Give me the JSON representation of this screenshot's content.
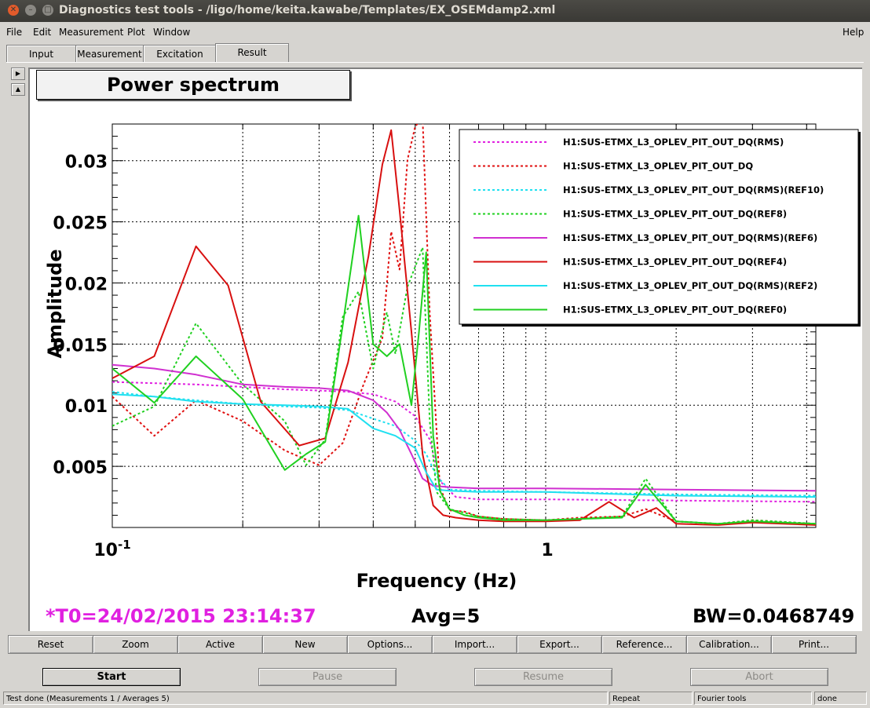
{
  "window": {
    "title": "Diagnostics test tools - /ligo/home/keita.kawabe/Templates/EX_OSEMdamp2.xml"
  },
  "menu": {
    "file": "File",
    "edit": "Edit",
    "measurement": "Measurement",
    "plot": "Plot",
    "window": "Window",
    "help": "Help"
  },
  "tabs": [
    "Input",
    "Measurement",
    "Excitation",
    "Result"
  ],
  "active_tab": "Result",
  "plot": {
    "title": "Power spectrum",
    "t0": "*T0=24/02/2015 23:14:37",
    "avg": "Avg=5",
    "bw": "BW=0.0468749"
  },
  "chart_data": {
    "type": "line",
    "title": "Power spectrum",
    "xlabel": "Frequency (Hz)",
    "ylabel": "Amplitude",
    "xscale": "log",
    "xlim": [
      0.1,
      4.2
    ],
    "ylim": [
      0,
      0.033
    ],
    "grid": true,
    "legend_position": "top-right",
    "x_ticks": [
      {
        "value": 0.1,
        "label": "10",
        "sup": "-1"
      },
      {
        "value": 1,
        "label": "1",
        "sup": ""
      }
    ],
    "y_ticks": [
      0.005,
      0.01,
      0.015,
      0.02,
      0.025,
      0.03
    ],
    "y_tick_labels": [
      "0.005",
      "0.01",
      "0.015",
      "0.02",
      "0.025",
      "0.03"
    ],
    "series": [
      {
        "name": "H1:SUS-ETMX_L3_OPLEV_PIT_OUT_DQ(RMS)",
        "color": "#e020e0",
        "style": "dotted",
        "x": [
          0.1,
          0.125,
          0.156,
          0.2,
          0.25,
          0.3,
          0.35,
          0.4,
          0.45,
          0.5,
          0.54,
          0.57,
          0.62,
          0.7,
          1,
          2,
          4.2
        ],
        "y": [
          0.0119,
          0.0118,
          0.0117,
          0.0115,
          0.0113,
          0.0112,
          0.0111,
          0.0109,
          0.0103,
          0.0091,
          0.0072,
          0.0038,
          0.0025,
          0.0023,
          0.0023,
          0.0022,
          0.0021
        ]
      },
      {
        "name": "H1:SUS-ETMX_L3_OPLEV_PIT_OUT_DQ",
        "color": "#e01010",
        "style": "dotted",
        "x": [
          0.1,
          0.125,
          0.156,
          0.2,
          0.25,
          0.3,
          0.34,
          0.38,
          0.42,
          0.44,
          0.46,
          0.48,
          0.5,
          0.52,
          0.54,
          0.57,
          0.6,
          0.65,
          0.7,
          0.8,
          1,
          1.2,
          1.5,
          1.7,
          2,
          2.5,
          3,
          4.2
        ],
        "y": [
          0.0107,
          0.0075,
          0.0104,
          0.0087,
          0.0063,
          0.0051,
          0.0069,
          0.0117,
          0.0155,
          0.0242,
          0.0211,
          0.0301,
          0.0328,
          0.0335,
          0.0175,
          0.0033,
          0.0014,
          0.0013,
          0.0009,
          0.0007,
          0.0006,
          0.0008,
          0.0009,
          0.0015,
          0.0005,
          0.0003,
          0.0006,
          0.0003
        ]
      },
      {
        "name": "H1:SUS-ETMX_L3_OPLEV_PIT_OUT_DQ(RMS)(REF10)",
        "color": "#20e0f0",
        "style": "dotted",
        "x": [
          0.1,
          0.125,
          0.156,
          0.2,
          0.25,
          0.3,
          0.35,
          0.4,
          0.45,
          0.5,
          0.53,
          0.56,
          0.6,
          0.7,
          1,
          2,
          4.2
        ],
        "y": [
          0.0111,
          0.0107,
          0.0104,
          0.0101,
          0.0099,
          0.0098,
          0.0096,
          0.0089,
          0.0083,
          0.0071,
          0.006,
          0.0042,
          0.0031,
          0.003,
          0.0029,
          0.0027,
          0.0026
        ]
      },
      {
        "name": "H1:SUS-ETMX_L3_OPLEV_PIT_OUT_DQ(REF8)",
        "color": "#20d020",
        "style": "dotted",
        "x": [
          0.1,
          0.125,
          0.156,
          0.2,
          0.25,
          0.28,
          0.31,
          0.34,
          0.37,
          0.4,
          0.43,
          0.45,
          0.48,
          0.52,
          0.54,
          0.56,
          0.6,
          0.65,
          0.7,
          0.8,
          1,
          1.2,
          1.5,
          1.7,
          2,
          2.5,
          3,
          4.2
        ],
        "y": [
          0.0083,
          0.0099,
          0.0167,
          0.0117,
          0.0087,
          0.0051,
          0.0072,
          0.0172,
          0.0193,
          0.013,
          0.0176,
          0.0142,
          0.0197,
          0.0229,
          0.0087,
          0.0029,
          0.0015,
          0.0012,
          0.0009,
          0.0007,
          0.0006,
          0.0007,
          0.0009,
          0.004,
          0.0005,
          0.0003,
          0.0006,
          0.0003
        ]
      },
      {
        "name": "H1:SUS-ETMX_L3_OPLEV_PIT_OUT_DQ(RMS)(REF6)",
        "color": "#d030d0",
        "style": "solid",
        "x": [
          0.1,
          0.125,
          0.156,
          0.2,
          0.25,
          0.3,
          0.35,
          0.4,
          0.43,
          0.46,
          0.49,
          0.52,
          0.55,
          0.6,
          0.7,
          1,
          2,
          4.2
        ],
        "y": [
          0.0133,
          0.013,
          0.0125,
          0.0117,
          0.0115,
          0.0114,
          0.0112,
          0.0104,
          0.0094,
          0.008,
          0.006,
          0.004,
          0.0034,
          0.0033,
          0.0032,
          0.0032,
          0.0031,
          0.003
        ]
      },
      {
        "name": "H1:SUS-ETMX_L3_OPLEV_PIT_OUT_DQ(REF4)",
        "color": "#d81010",
        "style": "solid",
        "x": [
          0.1,
          0.125,
          0.156,
          0.185,
          0.22,
          0.27,
          0.31,
          0.35,
          0.39,
          0.42,
          0.44,
          0.46,
          0.49,
          0.52,
          0.55,
          0.58,
          0.62,
          0.7,
          0.8,
          1,
          1.2,
          1.4,
          1.6,
          1.8,
          2,
          2.5,
          3,
          4.2
        ],
        "y": [
          0.0122,
          0.014,
          0.023,
          0.0198,
          0.0103,
          0.0067,
          0.0073,
          0.0135,
          0.0222,
          0.0297,
          0.0325,
          0.026,
          0.016,
          0.006,
          0.0018,
          0.001,
          0.0008,
          0.0006,
          0.0005,
          0.0005,
          0.0006,
          0.0021,
          0.0008,
          0.0016,
          0.0003,
          0.0002,
          0.0004,
          0.0002
        ]
      },
      {
        "name": "H1:SUS-ETMX_L3_OPLEV_PIT_OUT_DQ(RMS)(REF2)",
        "color": "#20e0f0",
        "style": "solid",
        "x": [
          0.1,
          0.125,
          0.156,
          0.2,
          0.25,
          0.3,
          0.35,
          0.4,
          0.45,
          0.5,
          0.53,
          0.56,
          0.6,
          0.7,
          1,
          2,
          4.2
        ],
        "y": [
          0.0109,
          0.0107,
          0.0103,
          0.0101,
          0.01,
          0.0099,
          0.0097,
          0.0081,
          0.0075,
          0.0065,
          0.0045,
          0.0031,
          0.003,
          0.0029,
          0.0029,
          0.0026,
          0.0025
        ]
      },
      {
        "name": "H1:SUS-ETMX_L3_OPLEV_PIT_OUT_DQ(REF0)",
        "color": "#20d020",
        "style": "solid",
        "x": [
          0.1,
          0.125,
          0.156,
          0.2,
          0.25,
          0.28,
          0.31,
          0.34,
          0.37,
          0.4,
          0.43,
          0.46,
          0.49,
          0.51,
          0.53,
          0.55,
          0.57,
          0.6,
          0.65,
          0.7,
          0.8,
          1,
          1.2,
          1.5,
          1.7,
          2,
          2.5,
          3,
          4.2
        ],
        "y": [
          0.013,
          0.0102,
          0.014,
          0.0105,
          0.0047,
          0.006,
          0.007,
          0.0165,
          0.0255,
          0.015,
          0.014,
          0.015,
          0.01,
          0.016,
          0.0225,
          0.0075,
          0.003,
          0.0015,
          0.001,
          0.0008,
          0.0006,
          0.0006,
          0.0007,
          0.0008,
          0.0035,
          0.0005,
          0.0003,
          0.0005,
          0.0003
        ]
      }
    ]
  },
  "plot_buttons": [
    "Reset",
    "Zoom",
    "Active",
    "New",
    "Options...",
    "Import...",
    "Export...",
    "Reference...",
    "Calibration...",
    "Print..."
  ],
  "controls": {
    "start": "Start",
    "pause": "Pause",
    "resume": "Resume",
    "abort": "Abort"
  },
  "status": {
    "message": "Test done (Measurements 1 / Averages 5)",
    "repeat": "Repeat",
    "fourier": "Fourier tools",
    "state": "done"
  }
}
